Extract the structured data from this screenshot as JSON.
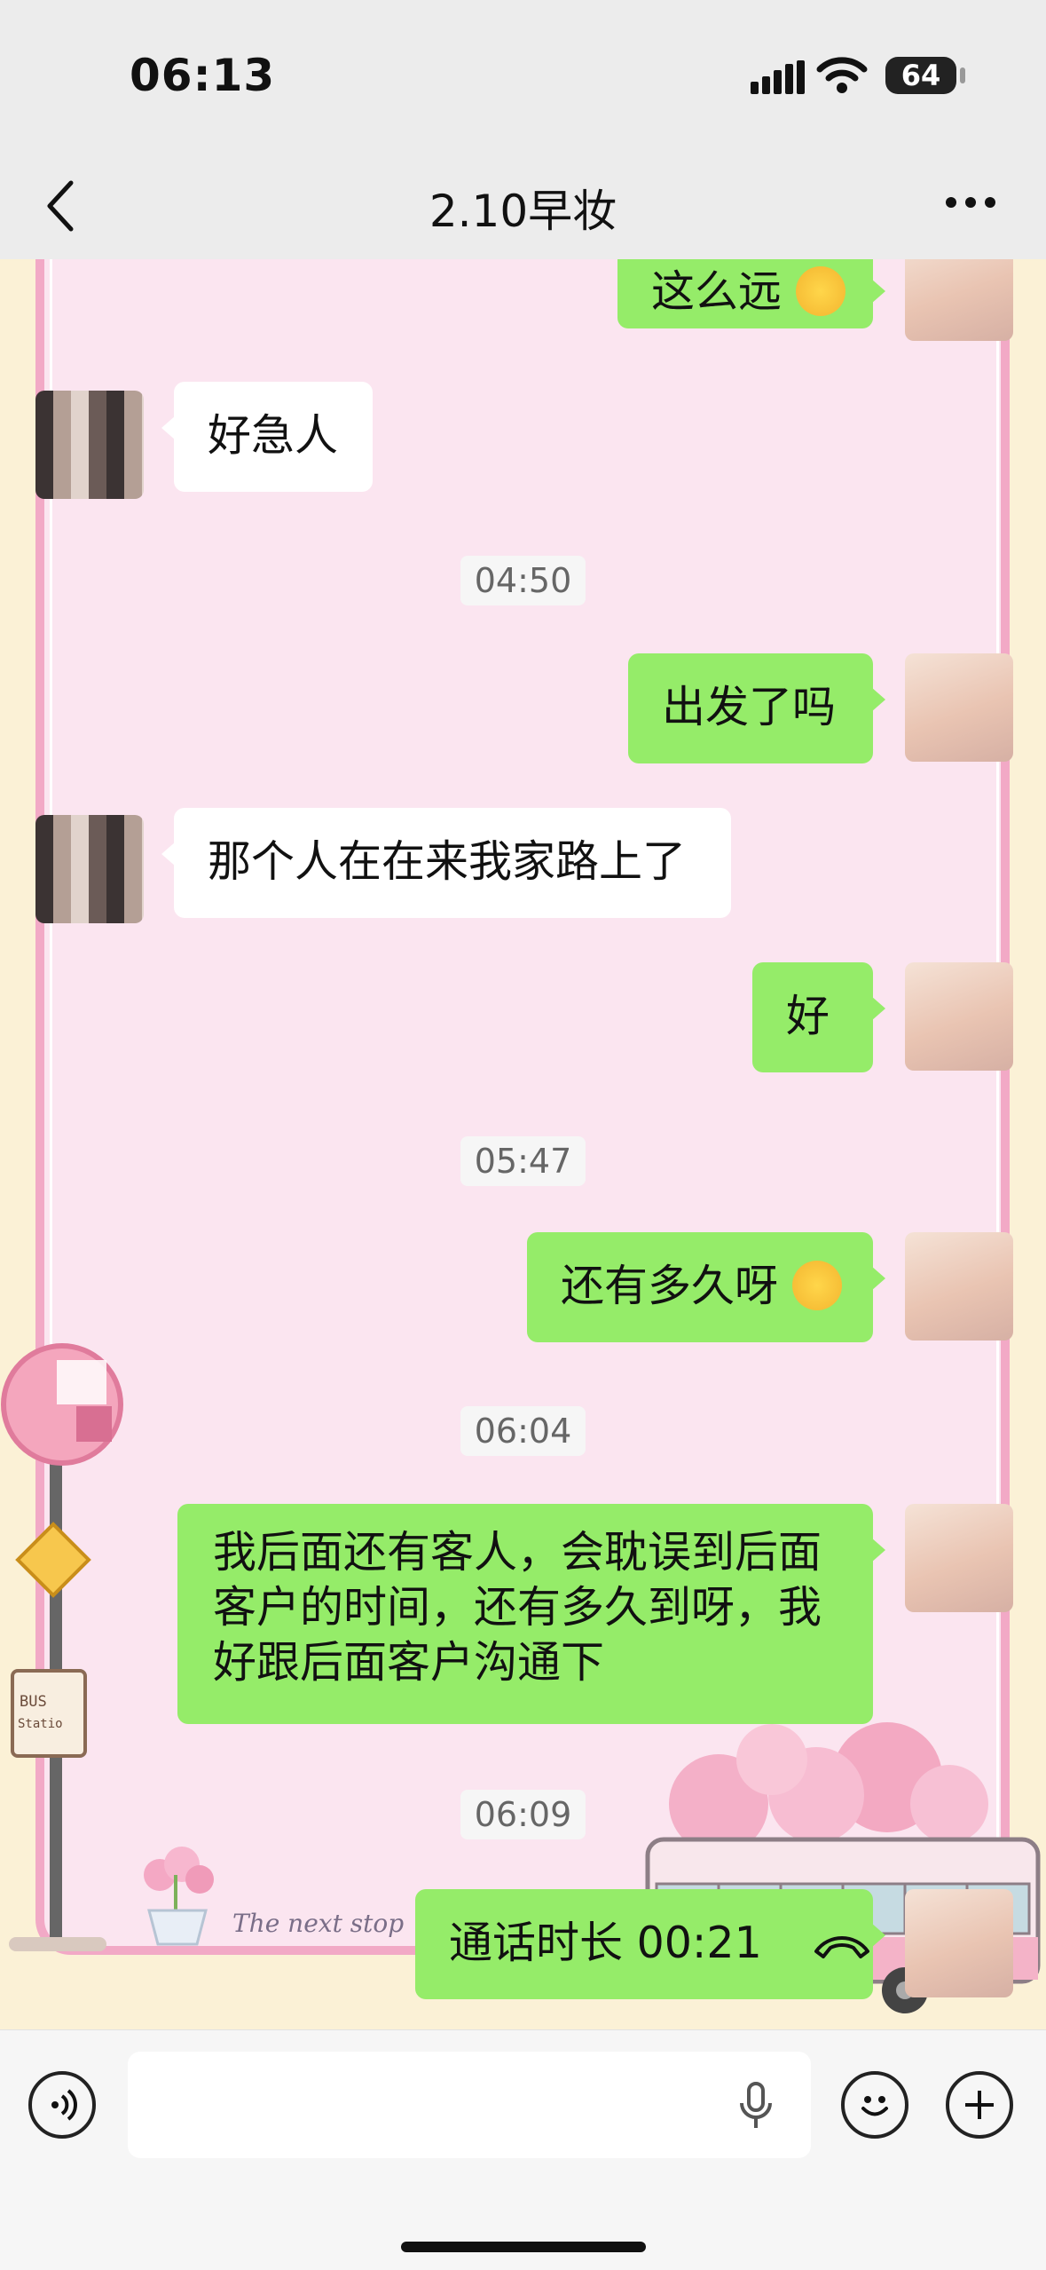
{
  "status": {
    "time": "06:13",
    "battery": "64"
  },
  "header": {
    "title": "2.10早妆"
  },
  "messages": {
    "m1": "这么远",
    "m2": "好急人",
    "t1": "04:50",
    "m3": "出发了吗",
    "m4": "那个人在在来我家路上了",
    "m5": "好",
    "t2": "05:47",
    "m6": "还有多久呀",
    "t3": "06:04",
    "m7": "我后面还有客人，会耽误到后面客户的时间，还有多久到呀，我好跟后面客户沟通下",
    "t4": "06:09",
    "m8": "通话时长 00:21"
  },
  "decor": {
    "bus_sign": "BUS Station",
    "banner": "The next stop"
  },
  "icons": [
    "back-icon",
    "more-icon",
    "voice-icon",
    "mic-icon",
    "emoji-icon",
    "plus-icon",
    "call-icon"
  ]
}
